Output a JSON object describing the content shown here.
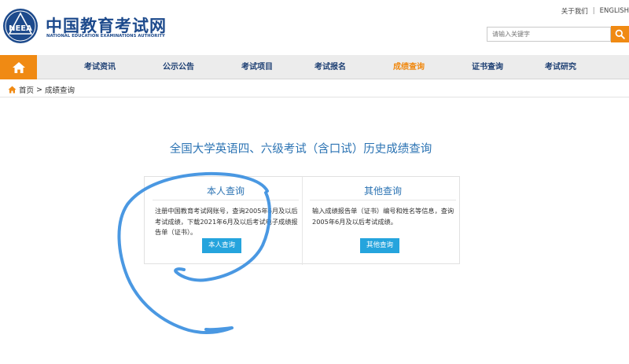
{
  "header": {
    "logo_text": "NEEA",
    "brand_cn": "中国教育考试网",
    "brand_en": "NATIONAL EDUCATION EXAMINATIONS AUTHORITY",
    "toplinks": {
      "about": "关于我们",
      "separator": "|",
      "english": "ENGLISH"
    },
    "search": {
      "placeholder": "请输入关键字",
      "icon": "search-icon"
    }
  },
  "nav": {
    "home_icon": "home-icon",
    "items": [
      {
        "label": "考试资讯",
        "active": false
      },
      {
        "label": "公示公告",
        "active": false
      },
      {
        "label": "考试项目",
        "active": false
      },
      {
        "label": "考试报名",
        "active": false
      },
      {
        "label": "成绩查询",
        "active": true
      },
      {
        "label": "证书查询",
        "active": false
      },
      {
        "label": "考试研究",
        "active": false
      }
    ]
  },
  "breadcrumb": {
    "home": "首页",
    "separator": ">",
    "current": "成绩查询"
  },
  "main": {
    "title": "全国大学英语四、六级考试（含口试）历史成绩查询",
    "cards": [
      {
        "title": "本人查询",
        "desc": "注册中国教育考试网账号，查询2005年6月及以后考试成绩，下载2021年6月及以后考试电子成绩报告单（证书）。",
        "button": "本人查询"
      },
      {
        "title": "其他查询",
        "desc": "输入成绩报告单（证书）编号和姓名等信息，查询2005年6月及以后考试成绩。",
        "button": "其他查询"
      }
    ]
  },
  "colors": {
    "brand_blue": "#1d4a8c",
    "accent_orange": "#f08a13",
    "title_blue": "#2b73b3",
    "button_blue": "#25a4dd",
    "annotation_blue": "#3b8fe0"
  }
}
